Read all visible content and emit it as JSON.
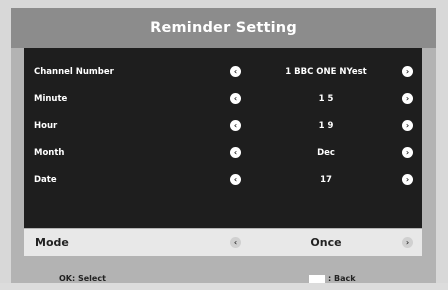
{
  "dialog": {
    "title": "Reminder Setting"
  },
  "rows": [
    {
      "label": "Channel Number",
      "value": "1  BBC ONE NYest"
    },
    {
      "label": "Minute",
      "value": "1 5"
    },
    {
      "label": "Hour",
      "value": "1 9"
    },
    {
      "label": "Month",
      "value": "Dec"
    },
    {
      "label": "Date",
      "value": "17"
    }
  ],
  "mode": {
    "label": "Mode",
    "value": "Once"
  },
  "arrows": {
    "left": "‹",
    "right": "›"
  },
  "footer": {
    "ok_hint": "OK: Select",
    "back_hint": ": Back"
  }
}
